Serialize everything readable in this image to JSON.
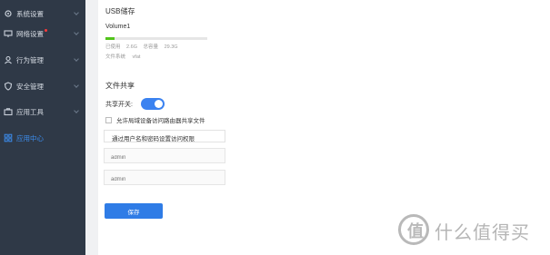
{
  "sidebar": {
    "items": [
      {
        "label": "系统设置",
        "icon": "gear-icon",
        "active": false
      },
      {
        "label": "网络设置",
        "icon": "network-icon",
        "active": false,
        "badge_color": "#ff3b3b"
      },
      {
        "label": "行为管理",
        "icon": "user-behavior-icon",
        "active": false
      },
      {
        "label": "安全管理",
        "icon": "shield-icon",
        "active": false
      },
      {
        "label": "应用工具",
        "icon": "toolbox-icon",
        "active": false
      },
      {
        "label": "应用中心",
        "icon": "app-center-icon",
        "active": true
      }
    ],
    "colors": {
      "background": "#2f3947",
      "active": "#3c8ef0"
    }
  },
  "usb": {
    "title": "USB储存",
    "volume_name": "Volume1",
    "used_label": "已使用",
    "used_value": "2.6G",
    "total_label": "总容量",
    "total_value": "29.3G",
    "usage_fraction": 0.09,
    "fs_label": "文件系统",
    "fs_value": "vfat"
  },
  "share": {
    "title": "文件共享",
    "switch_label": "共享开关:",
    "switch_on": true,
    "option_lan": "允许局域设备访问路由器共享文件",
    "option_auth": "通过用户名和密码设置访问权限",
    "username_placeholder": "admin",
    "password_placeholder": "admin",
    "save_label": "保存"
  },
  "watermark": {
    "logo_letter": "值",
    "text": "什么值得买"
  }
}
